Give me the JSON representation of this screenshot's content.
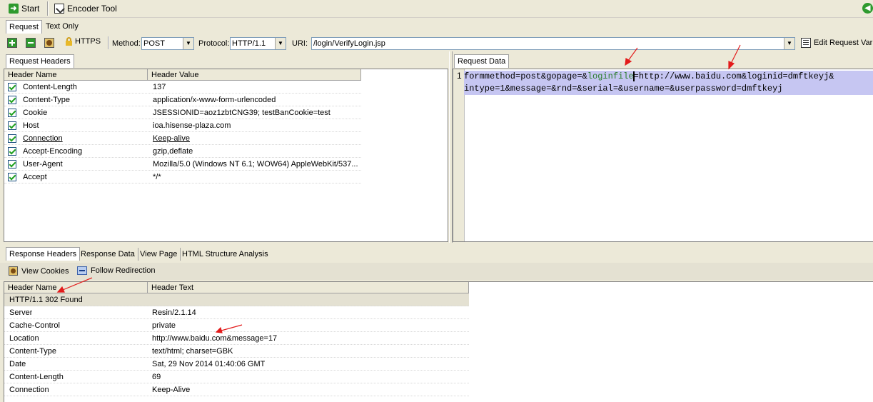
{
  "toolbar": {
    "start_label": "Start",
    "encoder_label": "Encoder Tool"
  },
  "request_tabs": [
    "Request",
    "Text Only"
  ],
  "request_bar": {
    "https_label": "HTTPS",
    "method_label": "Method:",
    "method_value": "POST",
    "protocol_label": "Protocol:",
    "protocol_value": "HTTP/1.1",
    "uri_label": "URI:",
    "uri_value": "/login/VerifyLogin.jsp",
    "edit_label": "Edit Request Vari"
  },
  "request_headers": {
    "tab": "Request Headers",
    "col_name": "Header Name",
    "col_value": "Header Value",
    "rows": [
      {
        "name": "Content-Length",
        "value": "137",
        "link": false
      },
      {
        "name": "Content-Type",
        "value": "application/x-www-form-urlencoded",
        "link": false
      },
      {
        "name": "Cookie",
        "value": "JSESSIONID=aoz1zbtCNG39; testBanCookie=test",
        "link": false
      },
      {
        "name": "Host",
        "value": "ioa.hisense-plaza.com",
        "link": false
      },
      {
        "name": "Connection",
        "value": "Keep-alive",
        "link": true
      },
      {
        "name": "Accept-Encoding",
        "value": "gzip,deflate",
        "link": false
      },
      {
        "name": "User-Agent",
        "value": "Mozilla/5.0 (Windows NT 6.1; WOW64) AppleWebKit/537...",
        "link": false
      },
      {
        "name": "Accept",
        "value": "*/*",
        "link": false
      }
    ]
  },
  "request_data": {
    "tab": "Request Data",
    "line_number": "1",
    "line1_a": "formmethod=post&gopage=&",
    "line1_hl": "loginfile",
    "line1_b": "=http://www.baidu.com&loginid=dmftkeyj&",
    "line2": "intype=1&message=&rnd=&serial=&username=&userpassword=dmftkeyj"
  },
  "response_tabs": [
    "Response Headers",
    "Response Data",
    "View Page",
    "HTML Structure Analysis"
  ],
  "response_bar": {
    "view_cookies": "View Cookies",
    "follow_redirection": "Follow Redirection"
  },
  "response_headers": {
    "col_name": "Header Name",
    "col_text": "Header Text",
    "status": "HTTP/1.1 302 Found",
    "rows": [
      {
        "name": "Server",
        "value": "Resin/2.1.14"
      },
      {
        "name": "Cache-Control",
        "value": "private"
      },
      {
        "name": "Location",
        "value": "http://www.baidu.com&message=17"
      },
      {
        "name": "Content-Type",
        "value": "text/html; charset=GBK"
      },
      {
        "name": "Date",
        "value": "Sat, 29 Nov 2014 01:40:06 GMT"
      },
      {
        "name": "Content-Length",
        "value": "69"
      },
      {
        "name": "Connection",
        "value": "Keep-Alive"
      }
    ]
  },
  "colors": {
    "annotation_arrow": "#e31b1b",
    "checkbox_check": "#21a121",
    "selection": "#c6c6f2",
    "highlight_text": "#2a7d2a"
  }
}
